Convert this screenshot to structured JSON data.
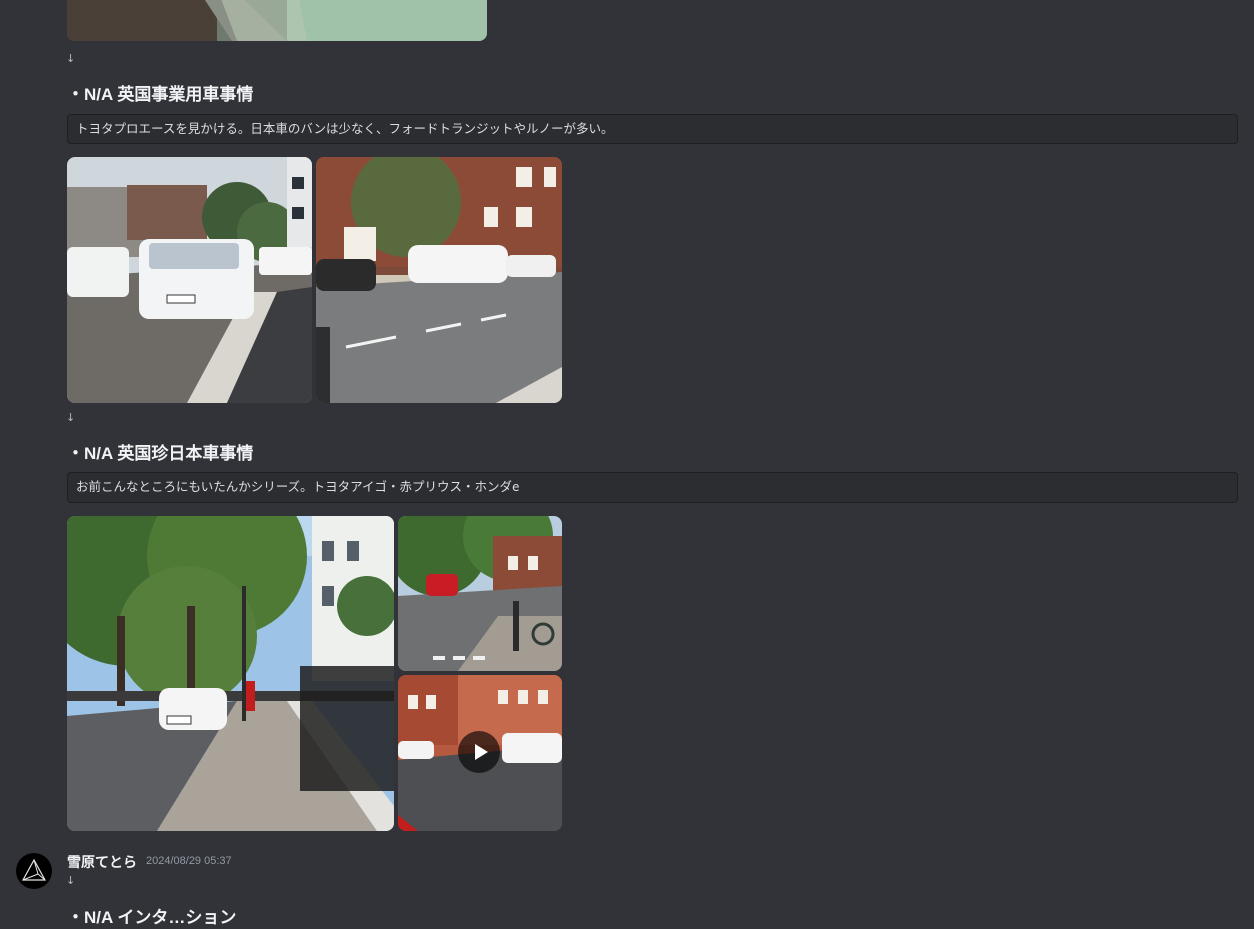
{
  "message": {
    "sections": [
      {
        "arrow": "↓",
        "heading": "・N/A 英国事業用車事情",
        "note": "トヨタプロエースを見かける。日本車のバンは少なく、フォードトランジットやルノーが多い。"
      },
      {
        "arrow": "↓",
        "heading": "・N/A 英国珍日本車事情",
        "note": "お前こんなところにもいたんかシリーズ。トヨタアイゴ・赤プリウス・ホンダe"
      }
    ],
    "top_arrow": "↓"
  },
  "next_message": {
    "username": "雪原てとら",
    "timestamp": "2024/08/29 05:37",
    "arrow": "↓",
    "heading_partial": "・N/A インタ…ション"
  },
  "icons": {
    "play": "play-icon",
    "avatar": "avatar-icon"
  },
  "colors": {
    "background": "#313338",
    "codebox": "#2b2d31",
    "text": "#dbdee1",
    "heading": "#f2f3f5",
    "muted": "#949ba4"
  }
}
